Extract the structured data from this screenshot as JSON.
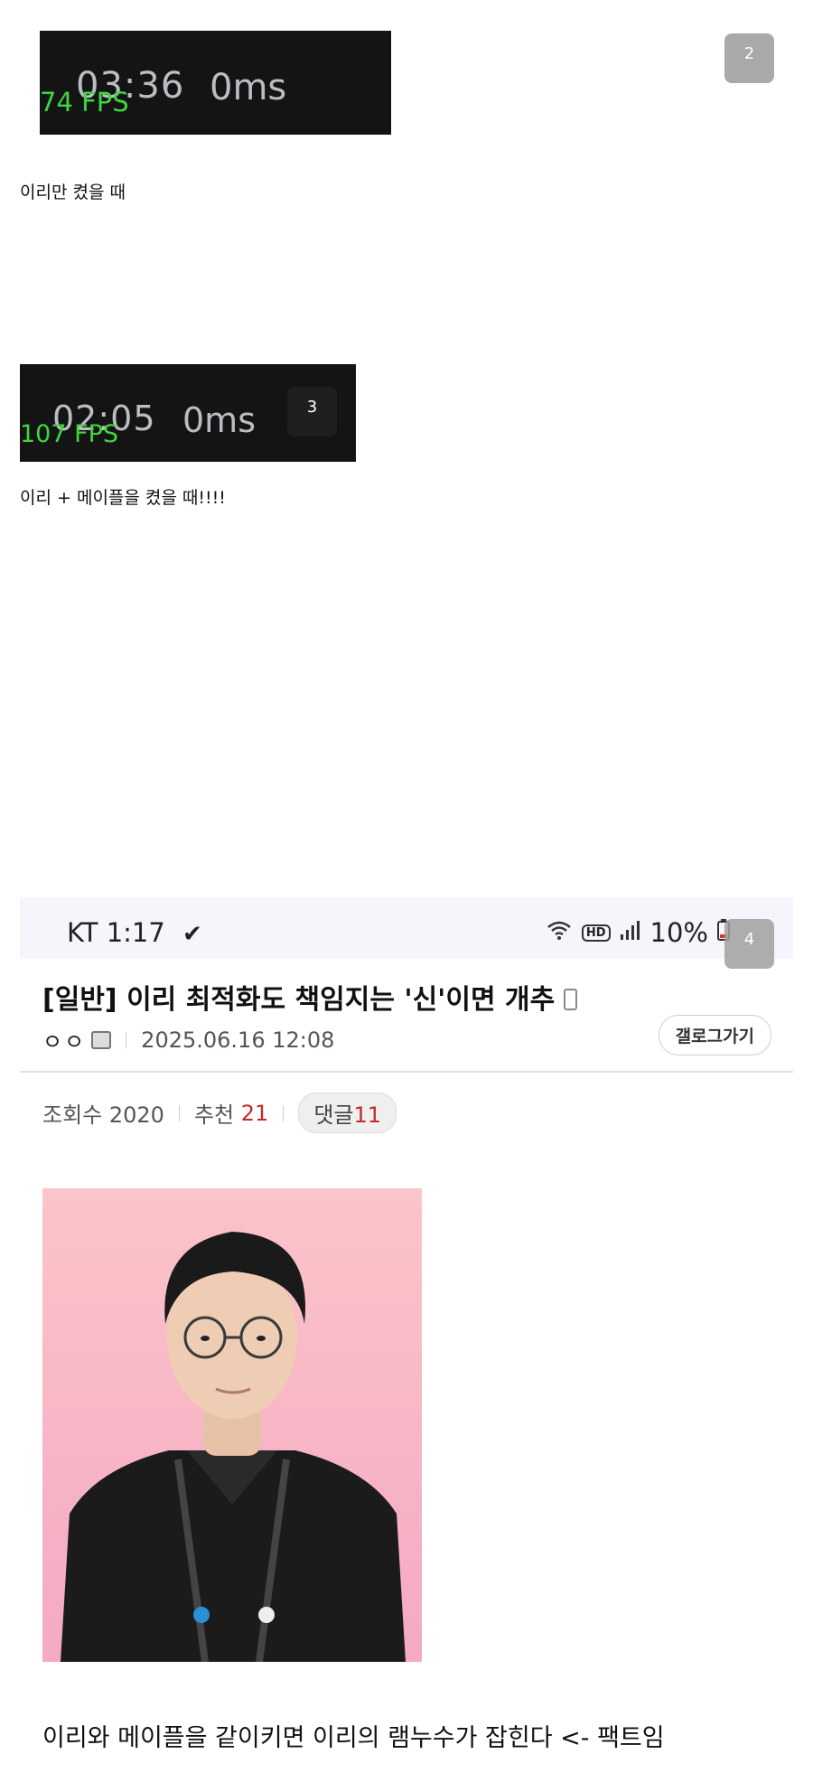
{
  "image1": {
    "timer": "03:36",
    "ping": "0ms",
    "fps": "74 FPS"
  },
  "badge1": "2",
  "caption1": "이리만 켰을 때",
  "image2": {
    "timer": "02:05",
    "ping": "0ms",
    "fps": "107 FPS"
  },
  "badge2": "3",
  "caption2": "이리 + 메이플을 켰을 때!!!!",
  "badge3": "4",
  "phone": {
    "statusbar": {
      "carrier_time": "KT 1:17",
      "hd": "HD",
      "battery": "10%"
    },
    "post": {
      "title": "[일반] 이리 최적화도 책임지는 '신'이면 개추",
      "author": "ㅇㅇ",
      "date": "2025.06.16 12:08",
      "gallog_button": "갤로그가기",
      "views_label": "조회수 2020",
      "recommend_label": "추천",
      "recommend_count": "21",
      "comment_label": "댓글",
      "comment_count": "11",
      "body_text": "이리와 메이플을 같이키면 이리의 램누수가 잡힌다 <- 팩트임"
    },
    "colors": {
      "accent_red": "#c02a2a",
      "fps_green": "#3fd63f"
    },
    "icons": [
      "check-icon",
      "wifi-icon",
      "signal-icon",
      "battery-icon",
      "mobile-icon",
      "author-icon"
    ]
  }
}
